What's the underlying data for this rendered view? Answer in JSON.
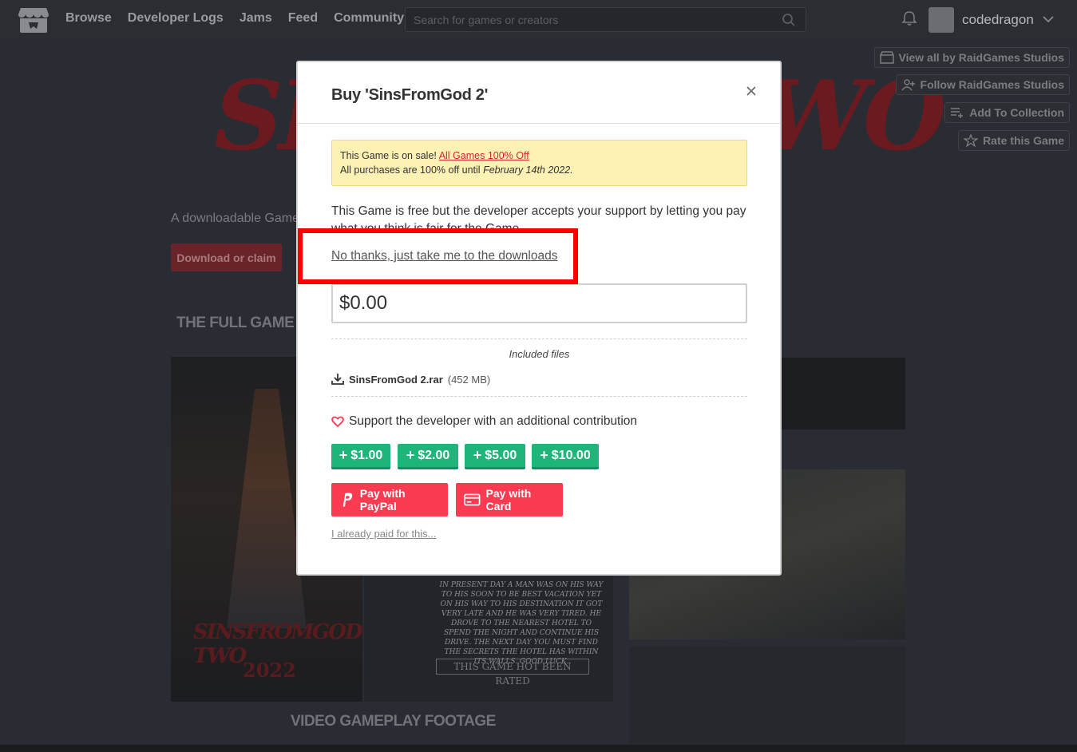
{
  "nav": {
    "links": [
      "Browse",
      "Developer Logs",
      "Jams",
      "Feed",
      "Community"
    ],
    "search_placeholder": "Search for games or creators",
    "username": "codedragon"
  },
  "background": {
    "banner": {
      "left": "SI",
      "right": "WO"
    },
    "side_buttons": [
      "View all by RaidGames Studios",
      "Follow RaidGames Studios",
      "Add To Collection",
      "Rate this Game"
    ],
    "tagline": "A downloadable Game",
    "download_button": "Download or claim",
    "section_full_game": "THE FULL GAME W",
    "section_video": "VIDEO GAMEPLAY FOOTAGE",
    "poster_title": "SINSFROMGOD TWO",
    "poster_year": "2022",
    "poster_story": "IN PRESENT DAY A MAN WAS ON HIS WAY TO HIS SOON TO BE BEST VACATION YET ON HIS WAY TO HIS DESTINATION IT GOT VERY LATE AND HE WAS VERY TIRED. HE DROVE TO THE NEAREST HOTEL TO SPEND THE NIGHT AND CONTINUE HIS DRIVE. THE NEXT DAY YOU MUST FIND THE SECRETS THE HOTEL HAS WITHIN ITS WALLS. GOOD LUCK.",
    "poster_rating": "THIS GAME HOT BEEN RATED"
  },
  "modal": {
    "title": "Buy 'SinsFromGod 2'",
    "sale": {
      "prefix": "This Game is on sale!",
      "link": "All Games 100% Off",
      "line2_prefix": "All purchases are 100% off until",
      "line2_date": "February 14th 2022."
    },
    "intro": "This Game is free but the developer accepts your support by letting you pay what you think is fair for the Game.",
    "no_thanks": "No thanks, just take me to the downloads",
    "amount": "$0.00",
    "included_files_label": "Included files",
    "file": {
      "name": "SinsFromGod 2.rar",
      "size": "(452 MB)"
    },
    "support_text": "Support the developer with an additional contribution",
    "contributions": [
      "$1.00",
      "$2.00",
      "$5.00",
      "$10.00"
    ],
    "pay_paypal": "Pay with PayPal",
    "pay_card": "Pay with Card",
    "already_paid": "I already paid for this..."
  },
  "colors": {
    "accent": "#fa3b52",
    "contribution_green": "#1fb57a",
    "sale_bg": "#fdf1b3",
    "highlight": "#ff0000"
  }
}
